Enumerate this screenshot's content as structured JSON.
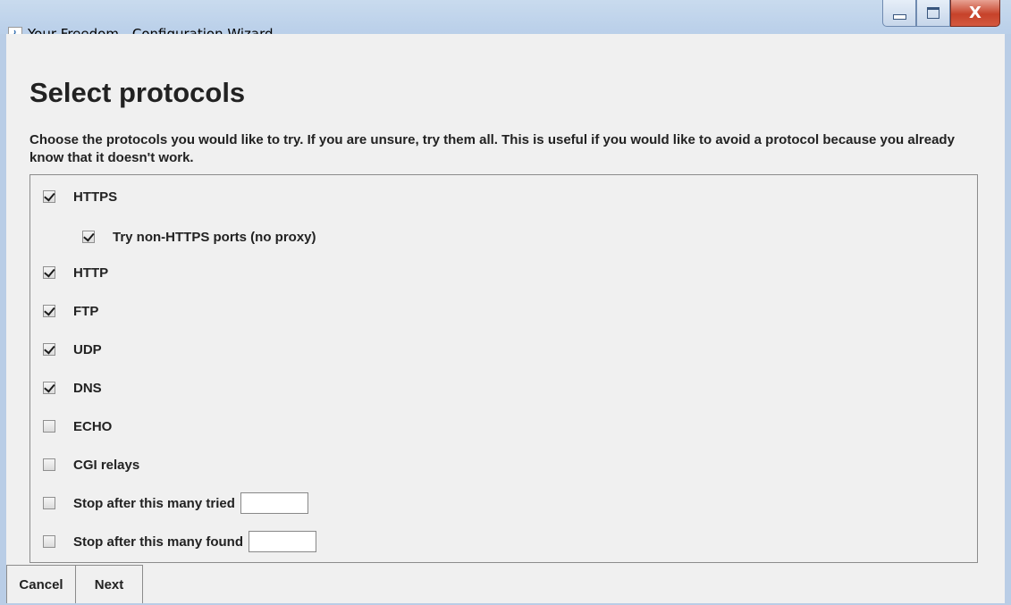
{
  "window": {
    "title": "Your Freedom - Configuration Wizard",
    "close_glyph": "X"
  },
  "page": {
    "heading": "Select protocols",
    "description": "Choose the protocols you would like to try. If you are unsure, try them all. This is useful if you would like to avoid a protocol because you already know that it doesn't work."
  },
  "options": [
    {
      "label": "HTTPS",
      "checked": true
    },
    {
      "label": "Try non-HTTPS ports (no proxy)",
      "checked": true
    },
    {
      "label": "HTTP",
      "checked": true
    },
    {
      "label": "FTP",
      "checked": true
    },
    {
      "label": "UDP",
      "checked": true
    },
    {
      "label": "DNS",
      "checked": true
    },
    {
      "label": "ECHO",
      "checked": false
    },
    {
      "label": "CGI relays",
      "checked": false
    },
    {
      "label": "Stop after this many tried",
      "checked": false,
      "value": ""
    },
    {
      "label": "Stop after this many found",
      "checked": false,
      "value": ""
    }
  ],
  "buttons": {
    "cancel": "Cancel",
    "next": "Next"
  }
}
